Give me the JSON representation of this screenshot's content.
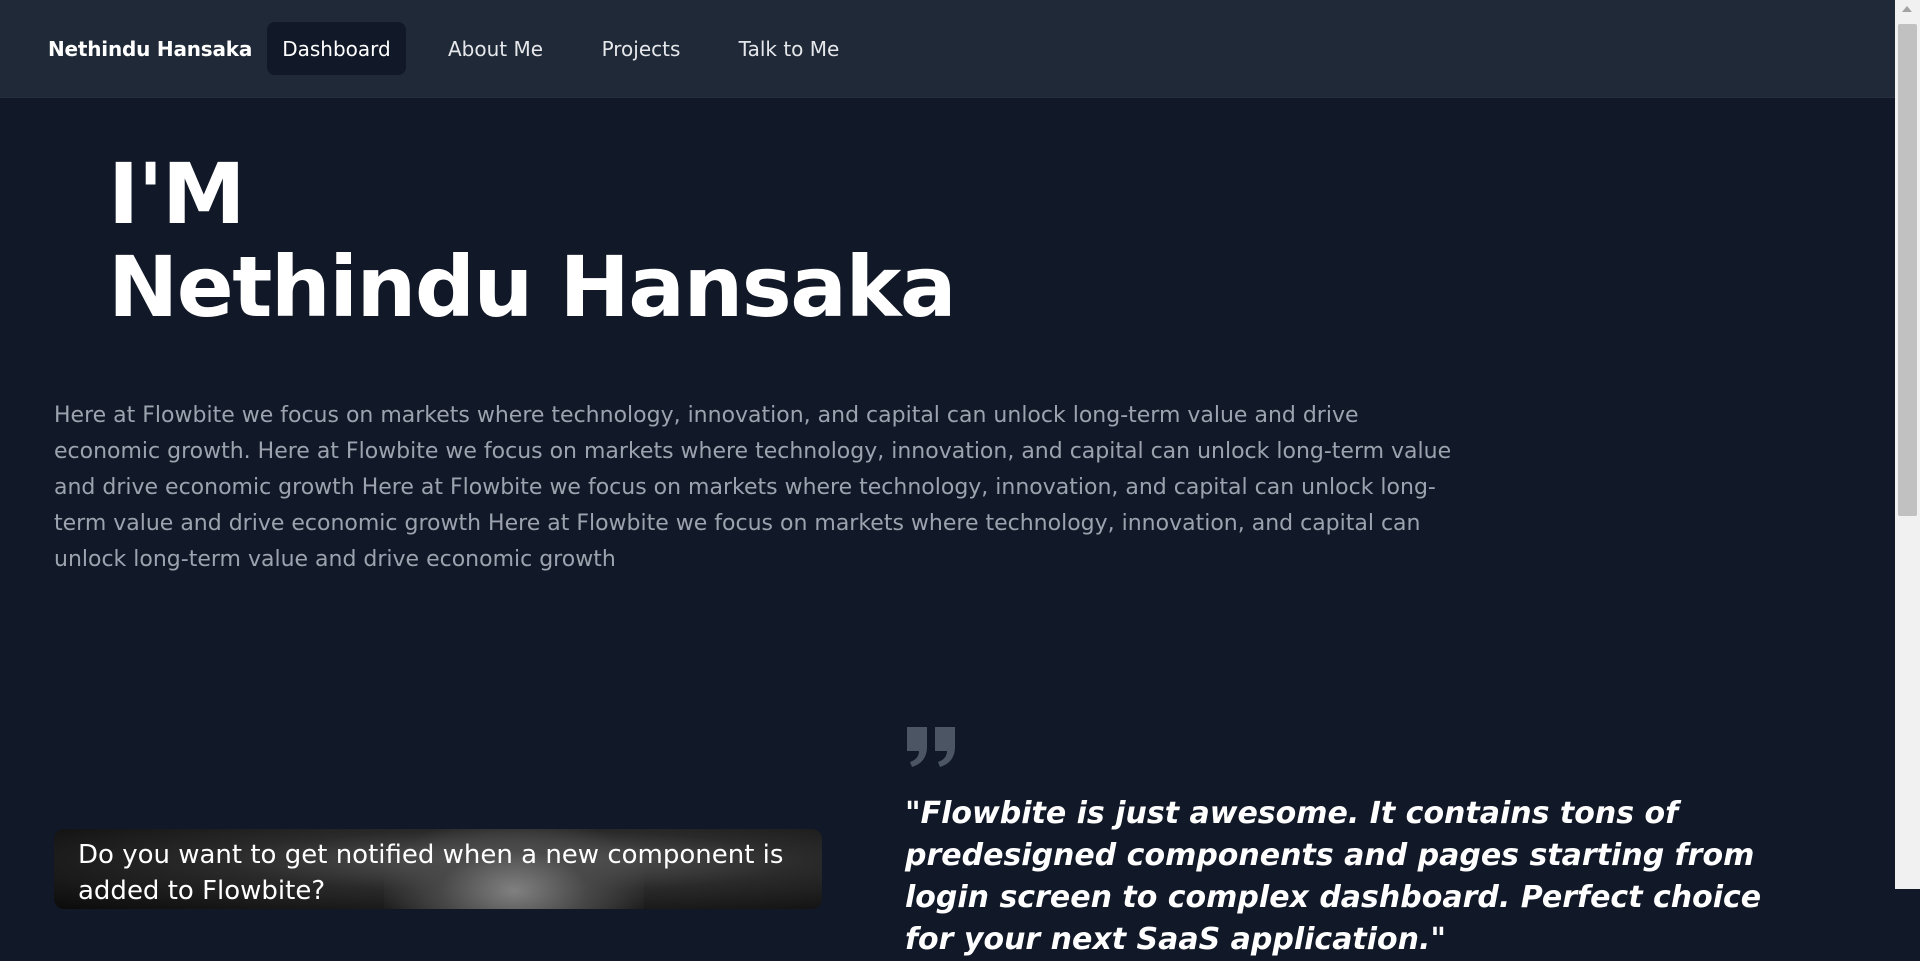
{
  "nav": {
    "brand": "Nethindu Hansaka",
    "items": [
      {
        "label": "Dashboard",
        "active": true
      },
      {
        "label": "About Me",
        "active": false
      },
      {
        "label": "Projects",
        "active": false
      },
      {
        "label": "Talk to Me",
        "active": false
      }
    ]
  },
  "hero": {
    "line1": "I'M",
    "line2": "Nethindu Hansaka",
    "description": "Here at Flowbite we focus on markets where technology, innovation, and capital can unlock long-term value and drive economic growth. Here at Flowbite we focus on markets where technology, innovation, and capital can unlock long-term value and drive economic growth Here at Flowbite we focus on markets where technology, innovation, and capital can unlock long-term value and drive economic growth Here at Flowbite we focus on markets where technology, innovation, and capital can unlock long-term value and drive economic growth"
  },
  "card": {
    "text": "Do you want to get notified when a new component is added to Flowbite?"
  },
  "testimonial": {
    "icon": "quote-icon",
    "text": "\"Flowbite is just awesome. It contains tons of predesigned components and pages starting from login screen to complex dashboard. Perfect choice for your next SaaS application.\""
  },
  "colors": {
    "background": "#111827",
    "navbar": "#1f2937",
    "muted_text": "#9ca3af",
    "quote_icon": "#4b5563"
  }
}
